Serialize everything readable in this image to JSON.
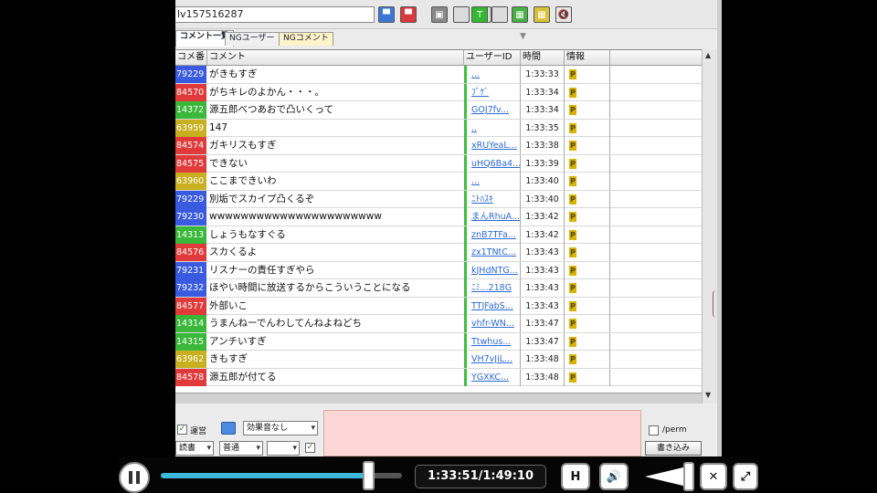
{
  "toolbar": {
    "live_id": "lv157516287",
    "buttons": [
      {
        "name": "blue-button",
        "color": "#3a78d8",
        "glyph": "▀"
      },
      {
        "name": "red-button",
        "color": "#d83a3a",
        "glyph": "▀"
      },
      {
        "name": "grey-button",
        "color": "#8a8a8a",
        "glyph": "▣"
      },
      {
        "name": "blank-button-1",
        "color": "#dcdcdc",
        "glyph": ""
      },
      {
        "name": "blank-button-2",
        "color": "#dcdcdc",
        "glyph": ""
      },
      {
        "name": "green-t-button",
        "color": "#34b834",
        "glyph": "T"
      },
      {
        "name": "blank-button-3",
        "color": "#dcdcdc",
        "glyph": ""
      },
      {
        "name": "green-button",
        "color": "#46b046",
        "glyph": "▦"
      },
      {
        "name": "yellow-button",
        "color": "#d8c23a",
        "glyph": "▦"
      },
      {
        "name": "speaker-button",
        "color": "#e8e8e8",
        "glyph": "🔇"
      }
    ]
  },
  "tabs": [
    {
      "label": "コメント一覧",
      "active": true
    },
    {
      "label": "NGユーザー",
      "active": false
    },
    {
      "label": "NGコメント",
      "active": false
    }
  ],
  "grid": {
    "columns": {
      "no": "コメ番",
      "comment": "コメント",
      "user_id": "ユーザーID",
      "time": "時間",
      "info": "情報"
    },
    "rows": [
      {
        "no": "79229",
        "color": "#3a5be0",
        "text": "がきもすぎ",
        "uid": "...",
        "time": "1:33:33"
      },
      {
        "no": "84570",
        "color": "#e03a3a",
        "text": "がちキレのよかん・・・。",
        "uid": "ﾌﾟｹﾞ",
        "time": "1:33:34"
      },
      {
        "no": "14372",
        "color": "#3ab83a",
        "text": "源五郎べつあおで凸いくって",
        "uid": "GOJ7fv...",
        "time": "1:33:34"
      },
      {
        "no": "63959",
        "color": "#c8b020",
        "text": "147",
        "uid": "..",
        "time": "1:33:35"
      },
      {
        "no": "84574",
        "color": "#e03a3a",
        "text": "ガキリスもすぎ",
        "uid": "xRUYeaL...",
        "time": "1:33:38"
      },
      {
        "no": "84575",
        "color": "#e03a3a",
        "text": "できない",
        "uid": "uHQ6Ba4...",
        "time": "1:33:39"
      },
      {
        "no": "63960",
        "color": "#c8b020",
        "text": "ここまできいわ",
        "uid": "...",
        "time": "1:33:40"
      },
      {
        "no": "79229",
        "color": "#3a5be0",
        "text": "別垢でスカイプ凸くるぞ",
        "uid": "ﾆﾄﾊｽｷ",
        "time": "1:33:40"
      },
      {
        "no": "79230",
        "color": "#3a5be0",
        "text": "wwwwwwwwwwwwwwwwwwwwww",
        "uid": "まんRhuA...",
        "time": "1:33:42"
      },
      {
        "no": "14313",
        "color": "#3ab83a",
        "text": "しょうもなすぐる",
        "uid": "znB7TFa...",
        "time": "1:33:42"
      },
      {
        "no": "84576",
        "color": "#e03a3a",
        "text": "スカくるよ",
        "uid": "zx1TNtC...",
        "time": "1:33:43"
      },
      {
        "no": "79231",
        "color": "#3a5be0",
        "text": "リスナーの責任すぎやら",
        "uid": "kJHdNTG...",
        "time": "1:33:43"
      },
      {
        "no": "79232",
        "color": "#3a5be0",
        "text": "ほやい時間に放送するからこういうことになる",
        "uid": "ﾆﾐ...218G",
        "time": "1:33:43"
      },
      {
        "no": "84577",
        "color": "#e03a3a",
        "text": "外部いこ",
        "uid": "TTJFabS...",
        "time": "1:33:43"
      },
      {
        "no": "14314",
        "color": "#3ab83a",
        "text": "うまんねーでんわしてんねよねどち",
        "uid": "vhfr-WN...",
        "time": "1:33:47"
      },
      {
        "no": "14315",
        "color": "#3ab83a",
        "text": "アンチいすぎ",
        "uid": "Ttwhus...",
        "time": "1:33:47"
      },
      {
        "no": "63962",
        "color": "#c8b020",
        "text": "きもすぎ",
        "uid": "VH7vJiL...",
        "time": "1:33:48"
      },
      {
        "no": "84578",
        "color": "#e03a3a",
        "text": "源五郎が付てる",
        "uid": "YGXKC...",
        "time": "1:33:48"
      }
    ]
  },
  "bottom": {
    "checkbox_label": "運営",
    "color_label": "色",
    "anchor_select": "読書",
    "command_select": "効果音なし",
    "size_select": "普通",
    "pos_select": "",
    "perm_label": "/perm",
    "write_label": "書き込み"
  },
  "player": {
    "time_text": "1:33:51/1:49:10",
    "progress_fraction": 0.857,
    "hq_label": "H"
  }
}
